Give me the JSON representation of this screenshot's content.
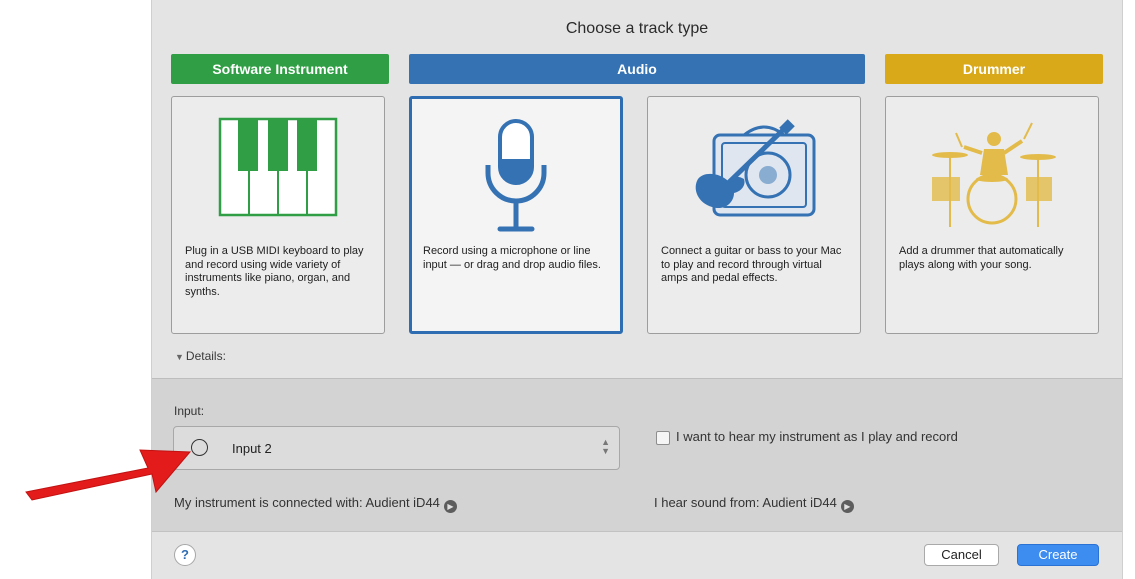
{
  "dialog": {
    "title": "Choose a track type",
    "categories": {
      "software_instrument": "Software Instrument",
      "audio": "Audio",
      "drummer": "Drummer"
    },
    "cards": [
      {
        "id": "software-instrument",
        "icon": "piano-keyboard-icon",
        "selected": false,
        "description": "Plug in a USB MIDI keyboard to play and record using wide variety of instruments like piano, organ, and synths."
      },
      {
        "id": "microphone",
        "icon": "microphone-icon",
        "selected": true,
        "description": "Record using a microphone or line input — or drag and drop audio files."
      },
      {
        "id": "guitar-bass",
        "icon": "guitar-amp-icon",
        "selected": false,
        "description": "Connect a guitar or bass to your Mac to play and record through virtual amps and pedal effects."
      },
      {
        "id": "drummer",
        "icon": "drummer-icon",
        "selected": false,
        "description": "Add a drummer that automatically plays along with your song."
      }
    ],
    "details_label": "Details:",
    "input": {
      "label": "Input:",
      "value": "Input 2"
    },
    "hear_checkbox": {
      "label": "I want to hear my instrument as I play and record",
      "checked": false
    },
    "connected_with": "My instrument is connected with: Audient iD44",
    "hear_from": "I hear sound from: Audient iD44",
    "buttons": {
      "help": "?",
      "cancel": "Cancel",
      "create": "Create"
    }
  },
  "colors": {
    "software": "#2f9e44",
    "audio": "#3472b4",
    "drummer": "#d9a91a",
    "arrow": "#e31b1b"
  }
}
